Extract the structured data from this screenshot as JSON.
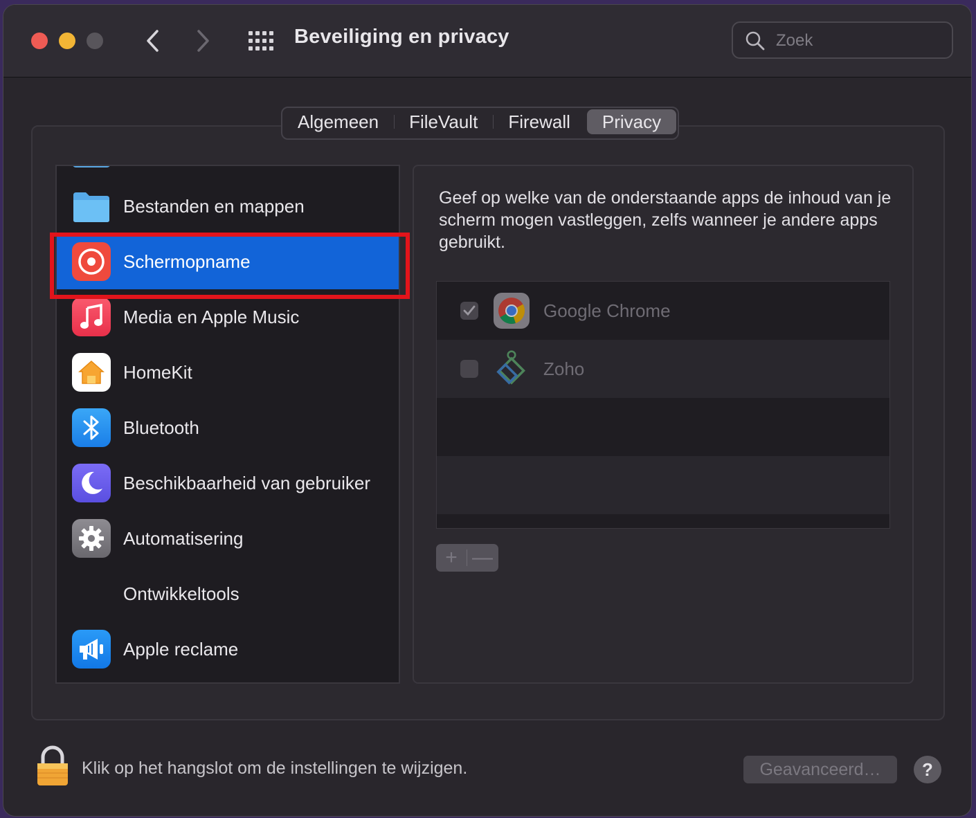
{
  "window": {
    "title": "Beveiliging en privacy",
    "search_placeholder": "Zoek"
  },
  "tabs": [
    {
      "label": "Algemeen",
      "active": false
    },
    {
      "label": "FileVault",
      "active": false
    },
    {
      "label": "Firewall",
      "active": false
    },
    {
      "label": "Privacy",
      "active": true
    }
  ],
  "sidebar": {
    "items": [
      {
        "label": "Bestanden en mappen",
        "icon": "folder-icon",
        "selected": false
      },
      {
        "label": "Schermopname",
        "icon": "screen-recording-icon",
        "selected": true
      },
      {
        "label": "Media en Apple Music",
        "icon": "music-icon",
        "selected": false
      },
      {
        "label": "HomeKit",
        "icon": "home-icon",
        "selected": false
      },
      {
        "label": "Bluetooth",
        "icon": "bluetooth-icon",
        "selected": false
      },
      {
        "label": "Beschikbaarheid van gebruiker",
        "icon": "moon-icon",
        "selected": false
      },
      {
        "label": "Automatisering",
        "icon": "gear-icon",
        "selected": false
      },
      {
        "label": "Ontwikkeltools",
        "icon": "",
        "selected": false
      },
      {
        "label": "Apple reclame",
        "icon": "megaphone-icon",
        "selected": false
      }
    ]
  },
  "detail": {
    "description": "Geef op welke van de onderstaande apps de inhoud van je scherm mogen vastleggen, zelfs wanneer je andere apps gebruikt.",
    "apps": [
      {
        "label": "Google Chrome",
        "checked": true,
        "icon": "chrome-icon"
      },
      {
        "label": "Zoho",
        "checked": false,
        "icon": "zoho-icon"
      }
    ],
    "add_label": "+",
    "remove_label": "—"
  },
  "footer": {
    "lock_text": "Klik op het hangslot om de instellingen te wijzigen.",
    "advanced_label": "Geavanceerd…",
    "help_label": "?"
  },
  "colors": {
    "selection": "#1264d8",
    "highlight_border": "#e2141b"
  }
}
